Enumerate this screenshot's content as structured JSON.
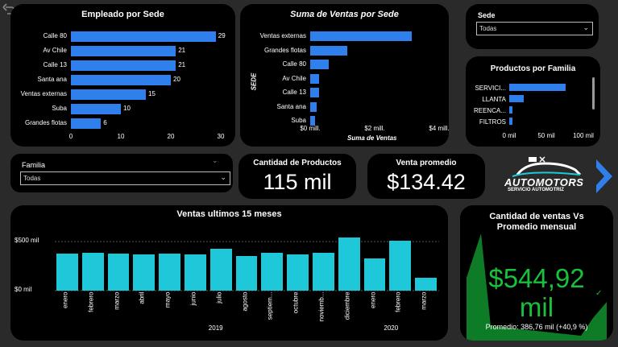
{
  "colors": {
    "bg": "#2a2a2a",
    "card": "#000000",
    "bar_blue": "#2f80ed",
    "bar_cyan": "#1ec8d8",
    "green": "#19c03b"
  },
  "icons": {
    "back": "back-arrow-icon",
    "chevron": "chevron-right-icon",
    "check": "check-icon"
  },
  "empleado": {
    "title": "Empleado por Sede",
    "chart_data": {
      "type": "bar",
      "orientation": "horizontal",
      "categories": [
        "Calle 80",
        "Av Chile",
        "Calle 13",
        "Santa ana",
        "Ventas externas",
        "Suba",
        "Grandes flotas"
      ],
      "values": [
        29,
        21,
        21,
        20,
        15,
        10,
        6
      ],
      "xlim": [
        0,
        30
      ],
      "xticks": [
        "0",
        "10",
        "20",
        "30"
      ]
    }
  },
  "ventas_sede": {
    "title": "Suma de Ventas por Sede",
    "chart_data": {
      "type": "bar",
      "orientation": "horizontal",
      "categories": [
        "Ventas externas",
        "Grandes flotas",
        "Calle 80",
        "Av Chile",
        "Calle 13",
        "Santa ana",
        "Suba"
      ],
      "values": [
        3.3,
        1.2,
        0.6,
        0.3,
        0.3,
        0.2,
        0.15
      ],
      "xlim": [
        0,
        4.2
      ],
      "xticks": [
        "$0 mill.",
        "$2 mill.",
        "$4 mill."
      ],
      "xlabel": "Suma de Ventas",
      "ylabel": "SEDE"
    }
  },
  "sede_filter": {
    "label": "Sede",
    "value": "Todas"
  },
  "productos_familia": {
    "title": "Productos por Familia",
    "chart_data": {
      "type": "bar",
      "orientation": "horizontal",
      "categories": [
        "SERVICI...",
        "LLANTA",
        "REENCA...",
        "FILTROS"
      ],
      "values": [
        80,
        20,
        5,
        4
      ],
      "xlim": [
        0,
        105
      ],
      "xticks": [
        "0 mil",
        "50 mil",
        "100 mil"
      ]
    }
  },
  "familia_filter": {
    "label": "Familia",
    "value": "Todas"
  },
  "kpi_cantidad": {
    "title": "Cantidad de Productos",
    "value": "115 mil"
  },
  "kpi_venta": {
    "title": "Venta promedio",
    "value": "$134.42"
  },
  "logo": {
    "brand": "AUTOMOTORS",
    "sub": "SERVICIO AUTOMOTRIZ"
  },
  "ventas_mes": {
    "title": "Ventas ultimos 15 meses",
    "chart_data": {
      "type": "bar",
      "categories": [
        "enero",
        "febrero",
        "marzo",
        "abril",
        "mayo",
        "junio",
        "julio",
        "agosto",
        "septiem...",
        "octubre",
        "noviemb...",
        "diciembre",
        "enero",
        "febrero",
        "marzo"
      ],
      "values": [
        380,
        385,
        375,
        372,
        378,
        368,
        428,
        350,
        383,
        372,
        388,
        545,
        328,
        508,
        128
      ],
      "ylim": [
        0,
        640
      ],
      "yticks": [
        "$0 mil",
        "$500 mil"
      ],
      "years": [
        "2019",
        "2020"
      ]
    }
  },
  "cantidad_vs": {
    "title": "Cantidad de ventas Vs Promedio mensual",
    "value_line1": "$544,92",
    "value_line2": "mil",
    "footer": "Promedio: 386,76 mil (+40,9 %)"
  }
}
